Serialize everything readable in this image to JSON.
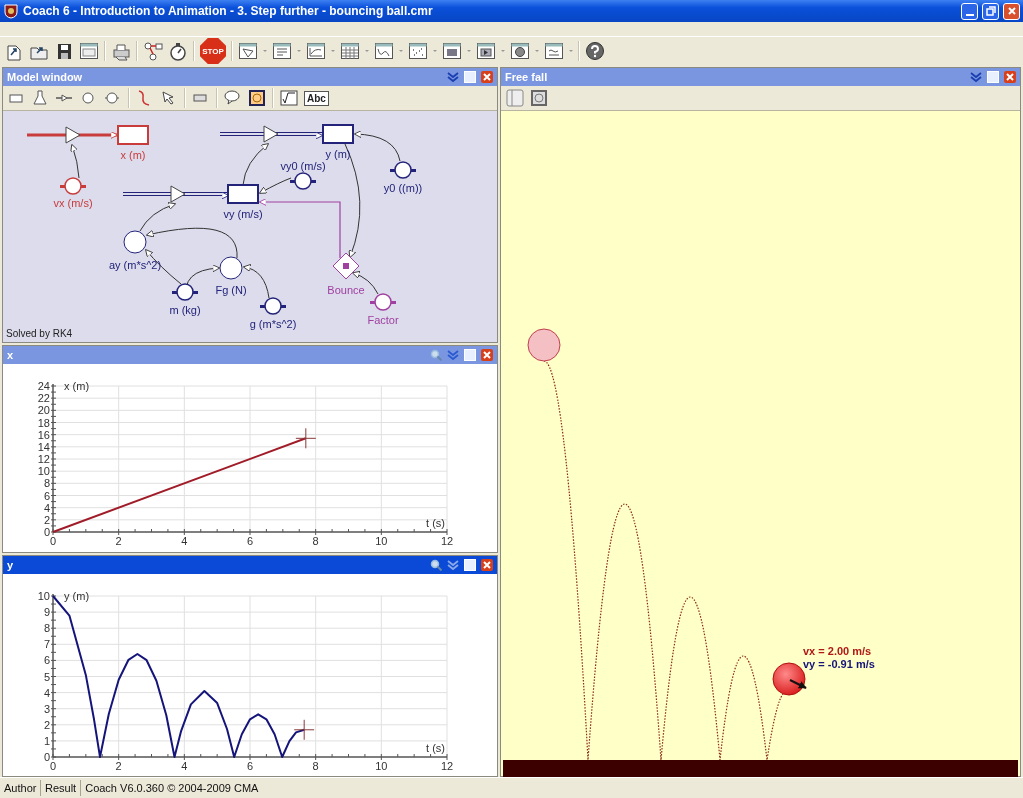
{
  "window": {
    "title": "Coach 6 - Introduction to Animation - 3. Step further - bouncing ball.cmr"
  },
  "toolbar": {
    "stop_label": "STOP"
  },
  "panels": [
    {
      "kind": "model",
      "title": "Model window",
      "active": false,
      "text_tool_label": "Abc",
      "solver": "Solved by RK4",
      "nodes": [
        {
          "label": "x (m)",
          "kind": "stock",
          "color": "#c83c3c"
        },
        {
          "label": "vx (m/s)",
          "kind": "constant",
          "color": "#c83c3c"
        },
        {
          "label": "y (m)",
          "kind": "stock",
          "color": "#23237a"
        },
        {
          "label": "y0 ((m))",
          "kind": "constant",
          "color": "#23237a"
        },
        {
          "label": "vy0 (m/s)",
          "kind": "constant",
          "color": "#23237a"
        },
        {
          "label": "vy (m/s)",
          "kind": "stock",
          "color": "#23237a"
        },
        {
          "label": "ay (m*s^2)",
          "kind": "variable",
          "color": "#23237a"
        },
        {
          "label": "Fg (N)",
          "kind": "variable",
          "color": "#23237a"
        },
        {
          "label": "m (kg)",
          "kind": "constant",
          "color": "#23237a"
        },
        {
          "label": "Bounce",
          "kind": "event",
          "color": "#a040a0"
        },
        {
          "label": "g (m*s^2)",
          "kind": "constant",
          "color": "#23237a"
        },
        {
          "label": "Factor",
          "kind": "constant",
          "color": "#a040a0"
        }
      ]
    },
    {
      "kind": "graph",
      "title": "x",
      "active": false,
      "chart_data": {
        "type": "line",
        "xlabel": "t (s)",
        "ylabel": "x (m)",
        "x": [
          0,
          7.7
        ],
        "series": [
          {
            "color": "#a01c28",
            "values": [
              0,
              15.4
            ]
          }
        ],
        "grid": true,
        "xlim": [
          0,
          12
        ],
        "ylim": [
          0,
          24
        ],
        "xticks": [
          0,
          2,
          4,
          6,
          8,
          10,
          12
        ],
        "yticks": [
          0,
          2,
          4,
          6,
          8,
          10,
          12,
          14,
          16,
          18,
          20,
          22,
          24
        ]
      }
    },
    {
      "kind": "graph",
      "title": "y",
      "active": true,
      "chart_data": {
        "type": "line",
        "xlabel": "t (s)",
        "ylabel": "y (m)",
        "x": [
          0,
          0.5,
          1,
          1.25,
          1.43,
          1.7,
          2.0,
          2.3,
          2.57,
          2.85,
          3.15,
          3.45,
          3.7,
          3.9,
          4.2,
          4.61,
          5.0,
          5.3,
          5.52,
          5.75,
          6.0,
          6.25,
          6.5,
          6.75,
          6.98,
          7.2,
          7.4,
          7.65
        ],
        "series": [
          {
            "color": "#14147a",
            "values": [
              10,
              8.78,
              5.1,
              2.34,
              0,
              2.67,
              4.8,
              6.04,
              6.4,
              6.01,
              4.74,
              2.59,
              0,
              1.61,
              3.27,
              4.1,
              3.35,
              1.74,
              0,
              1.41,
              2.34,
              2.65,
              2.34,
              1.41,
              0,
              0.99,
              1.53,
              1.69
            ]
          }
        ],
        "grid": true,
        "xlim": [
          0,
          12
        ],
        "ylim": [
          0,
          10
        ],
        "xticks": [
          0,
          2,
          4,
          6,
          8,
          10,
          12
        ],
        "yticks": [
          0,
          1,
          2,
          3,
          4,
          5,
          6,
          7,
          8,
          9,
          10
        ]
      }
    },
    {
      "kind": "animation",
      "title": "Free fall",
      "active": false,
      "labels": [
        {
          "text": "vx = 2.00 m/s",
          "color": "#b01818"
        },
        {
          "text": "vy = -0.91 m/s",
          "color": "#14147a"
        }
      ]
    }
  ],
  "status_bar": [
    "Author",
    "Result",
    "Coach V6.0.360 © 2004-2009 CMA"
  ]
}
